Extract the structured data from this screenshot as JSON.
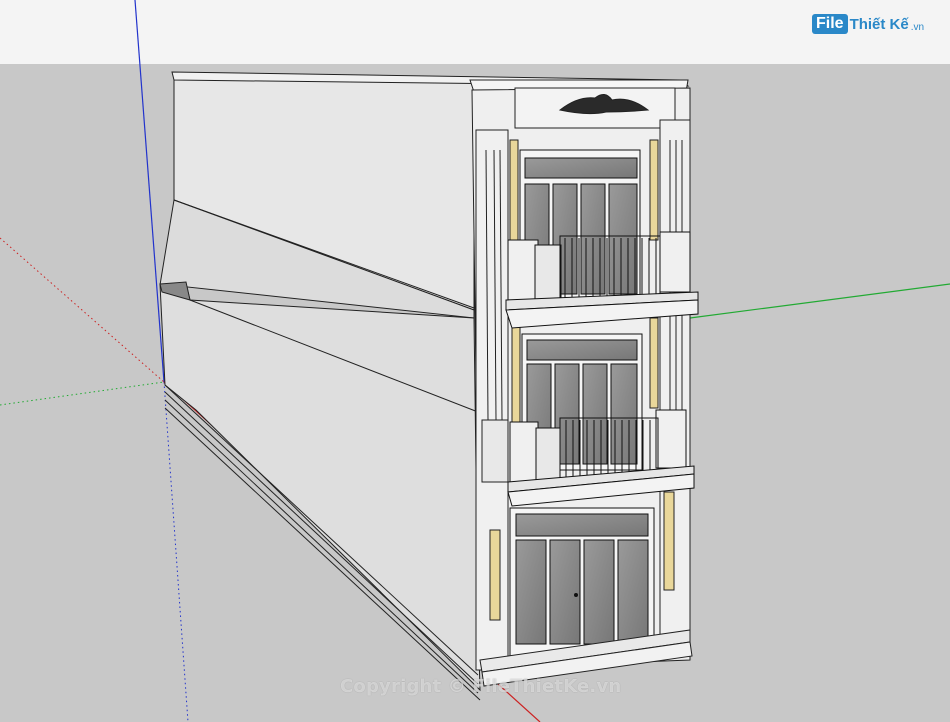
{
  "watermark": {
    "logo_file": "File",
    "logo_rest": "Thiết Kế",
    "logo_domain": ".vn",
    "copyright": "Copyright © FileThietKe.vn"
  },
  "scene": {
    "sky_color": "#f4f4f4",
    "ground_color": "#c8c8c8",
    "axis_colors": {
      "blue": "#2233cc",
      "red": "#cc2222",
      "green": "#22aa33"
    },
    "accent_gold": "#e9d79a",
    "window_glass": "#8a8a8a"
  }
}
